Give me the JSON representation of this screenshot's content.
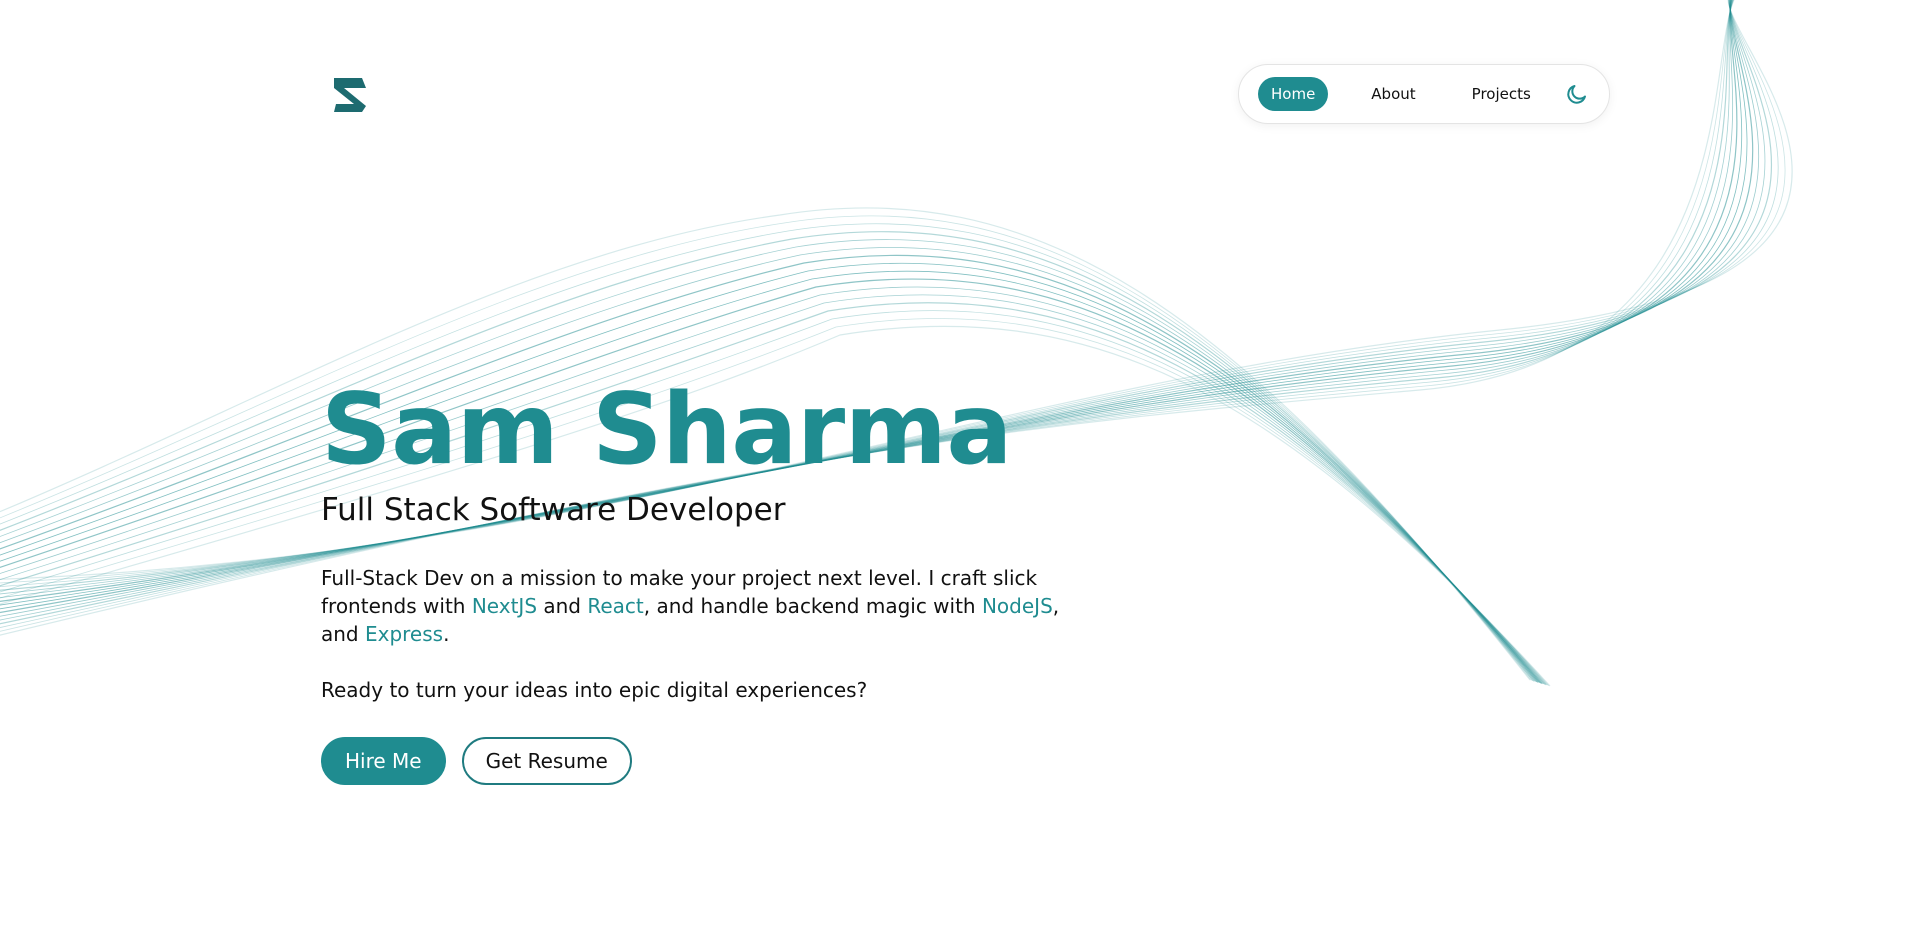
{
  "colors": {
    "accent": "#1f8c90",
    "text": "#111111",
    "background": "#ffffff"
  },
  "header": {
    "logo_icon": "s-logo-icon",
    "nav": {
      "items": [
        {
          "label": "Home",
          "active": true
        },
        {
          "label": "About",
          "active": false
        },
        {
          "label": "Projects",
          "active": false
        }
      ],
      "theme_toggle_icon": "moon-icon"
    }
  },
  "hero": {
    "name": "Sam Sharma",
    "role": "Full Stack Software Developer",
    "description": {
      "part1": "Full-Stack Dev on a mission to make your project next level. I craft slick frontends with ",
      "tech1": "NextJS",
      "part2": " and ",
      "tech2": "React",
      "part3": ", and handle backend magic with ",
      "tech3": "NodeJS",
      "part4": ", and ",
      "tech4": "Express",
      "part5": "."
    },
    "cta_text": "Ready to turn your ideas into epic digital experiences?",
    "buttons": {
      "hire_label": "Hire Me",
      "resume_label": "Get Resume"
    }
  }
}
